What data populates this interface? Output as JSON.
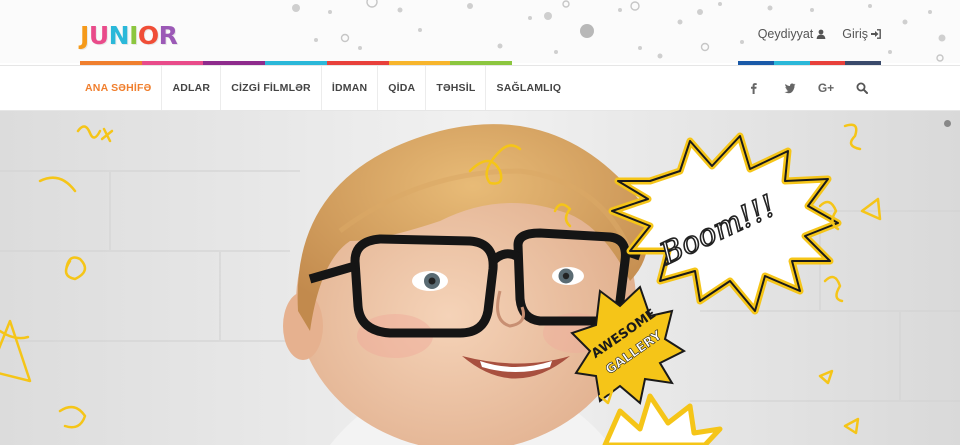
{
  "brand": {
    "logo_letters": [
      "J",
      "U",
      "N",
      "I",
      "O",
      "R"
    ],
    "logo_colors": [
      "#f59a1b",
      "#e94b8a",
      "#2bb8d9",
      "#8cc63f",
      "#f04e37",
      "#9b59b6"
    ]
  },
  "header": {
    "register_label": "Qeydiyyat",
    "login_label": "Giriş",
    "accent_bar_colors": [
      "#f07f2e",
      "#e94b8a",
      "#8e2b8c",
      "#2bb8d9",
      "#e8403b",
      "#f7b52c",
      "#8cc63f"
    ],
    "right_bar_colors": [
      "#1a5aa8",
      "#2bb8d9",
      "#e8403b",
      "#3a4a6b"
    ]
  },
  "nav": {
    "items": [
      {
        "label": "ANA SƏHİFƏ",
        "active": true
      },
      {
        "label": "ADLAR",
        "active": false
      },
      {
        "label": "CİZGİ FİLMLƏR",
        "active": false
      },
      {
        "label": "İDMAN",
        "active": false
      },
      {
        "label": "QİDA",
        "active": false
      },
      {
        "label": "TƏHSİL",
        "active": false
      },
      {
        "label": "SAĞLAMLIQ",
        "active": false
      }
    ],
    "social_icons": [
      "facebook-icon",
      "twitter-icon",
      "google-plus-icon",
      "search-icon"
    ],
    "google_plus_label": "G+"
  },
  "hero": {
    "bubble_text": "Boom!!!",
    "badge_line1": "AWESOME",
    "badge_line2": "GALLERY",
    "accent_color": "#f5c518"
  }
}
